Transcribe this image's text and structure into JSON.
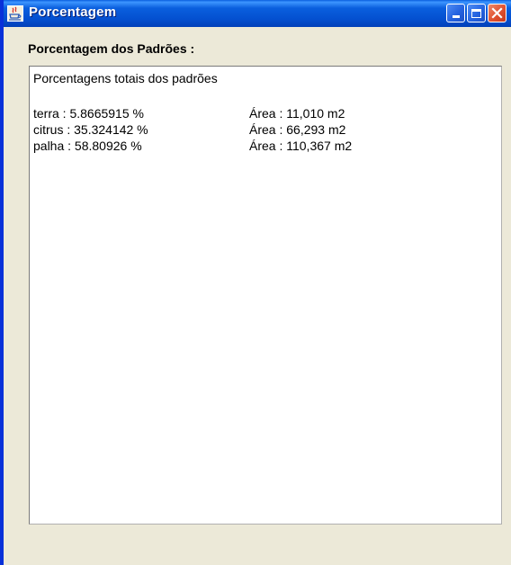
{
  "window": {
    "title": "Porcentagem",
    "controls": [
      "minimize",
      "maximize",
      "close"
    ]
  },
  "group": {
    "label": "Porcentagem dos Padrões :"
  },
  "text_area": {
    "heading": "Porcentagens totais dos padrões",
    "rows": [
      {
        "percentage": "terra : 5.8665915 %",
        "area": "Área : 11,010 m2"
      },
      {
        "percentage": "citrus : 35.324142 %",
        "area": "Área : 66,293 m2"
      },
      {
        "percentage": "palha : 58.80926 %",
        "area": "Área : 110,367 m2"
      }
    ]
  },
  "icons": {
    "app": "java-app-icon",
    "minimize": "minimize-icon",
    "maximize": "maximize-icon",
    "close": "close-icon"
  },
  "colors": {
    "titlebar": "#0a5fde",
    "window_bg": "#ece9d8",
    "close_button": "#e0512f"
  }
}
